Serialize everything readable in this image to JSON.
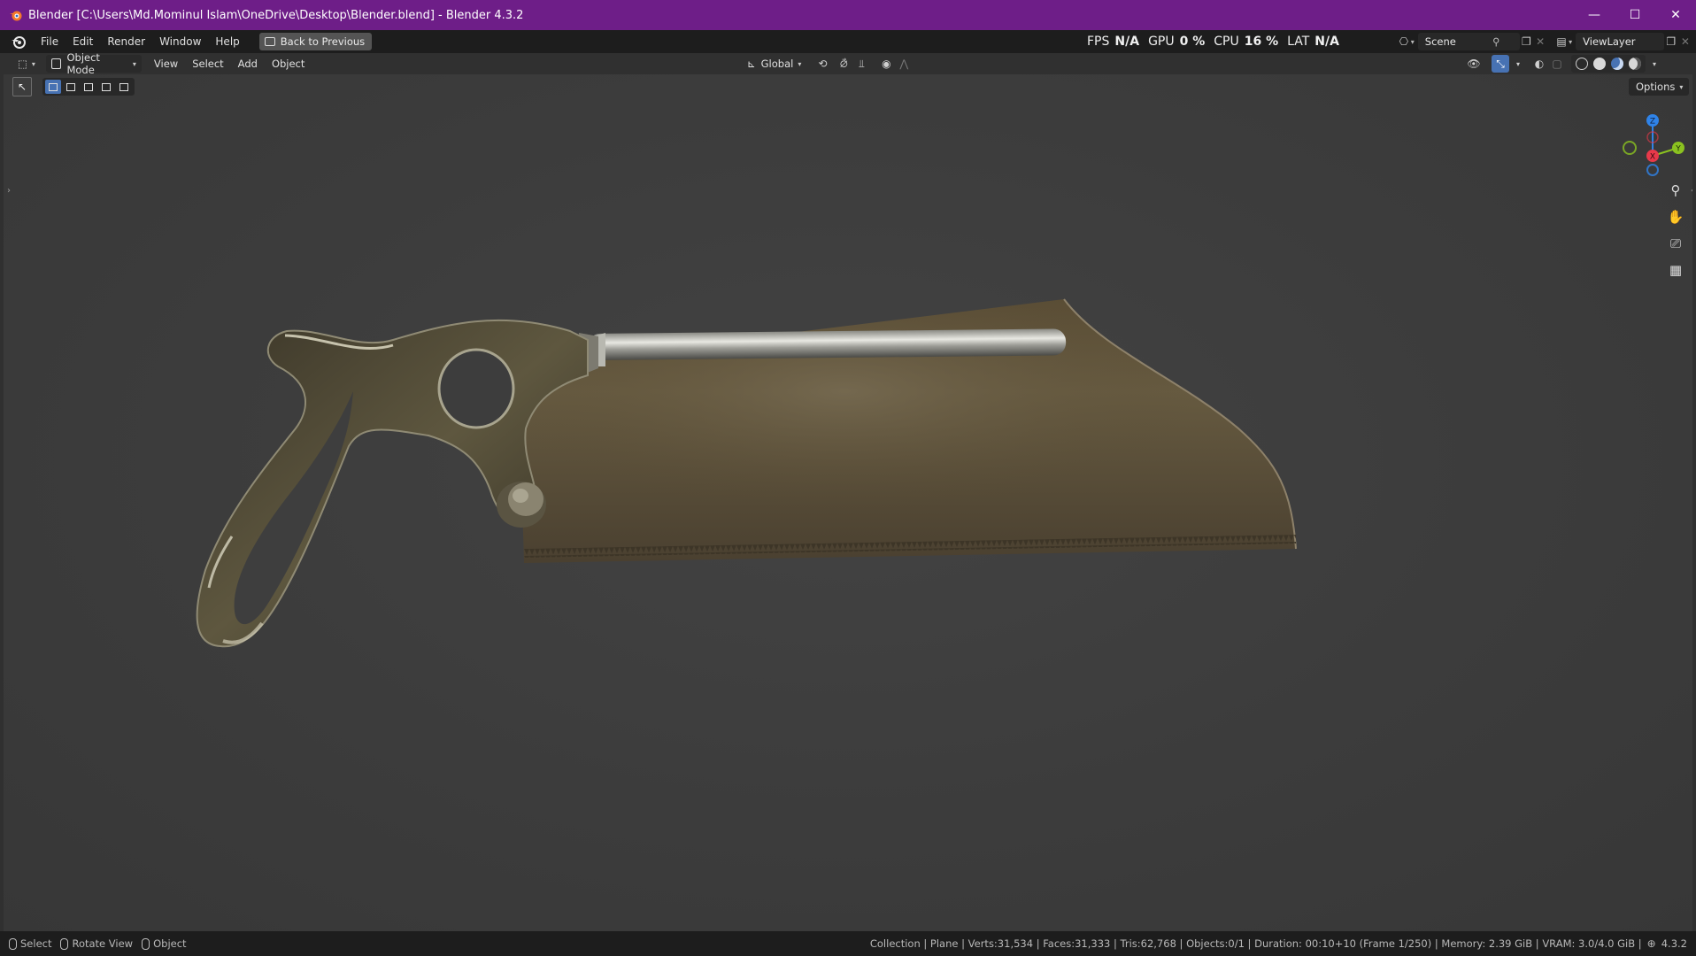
{
  "window": {
    "title": "Blender [C:\\Users\\Md.Mominul Islam\\OneDrive\\Desktop\\Blender.blend] - Blender 4.3.2",
    "controls": [
      "—",
      "☐",
      "✕"
    ]
  },
  "menubar": {
    "items": [
      "File",
      "Edit",
      "Render",
      "Window",
      "Help"
    ],
    "back_button": "Back to Previous"
  },
  "perf_stats": {
    "fps_label": "FPS",
    "fps_value": "N/A",
    "gpu_label": "GPU",
    "gpu_value": "0 %",
    "cpu_label": "CPU",
    "cpu_value": "16 %",
    "lat_label": "LAT",
    "lat_value": "N/A"
  },
  "scene": {
    "name": "Scene"
  },
  "view_layer": {
    "name": "ViewLayer"
  },
  "viewport_header": {
    "mode": "Object Mode",
    "menus": [
      "View",
      "Select",
      "Add",
      "Object"
    ],
    "transform_orientation": "Global",
    "options_label": "Options"
  },
  "gizmo": {
    "z_label": "Z",
    "y_label": "Y",
    "x_label": "X"
  },
  "status": {
    "left": [
      {
        "label": "Select"
      },
      {
        "label": "Rotate View"
      },
      {
        "label": "Object"
      }
    ],
    "right": "Collection | Plane | Verts:31,534 | Faces:31,333 | Tris:62,768 | Objects:0/1 | Duration: 00:10+10 (Frame 1/250) | Memory: 2.39 GiB | VRAM: 3.0/4.0 GiB |",
    "version": "4.3.2"
  },
  "colors": {
    "titlebar": "#6e1e88",
    "accent": "#4772b3",
    "axis_x": "#e8394a",
    "axis_y": "#8bc220",
    "axis_z": "#2f83e8"
  }
}
